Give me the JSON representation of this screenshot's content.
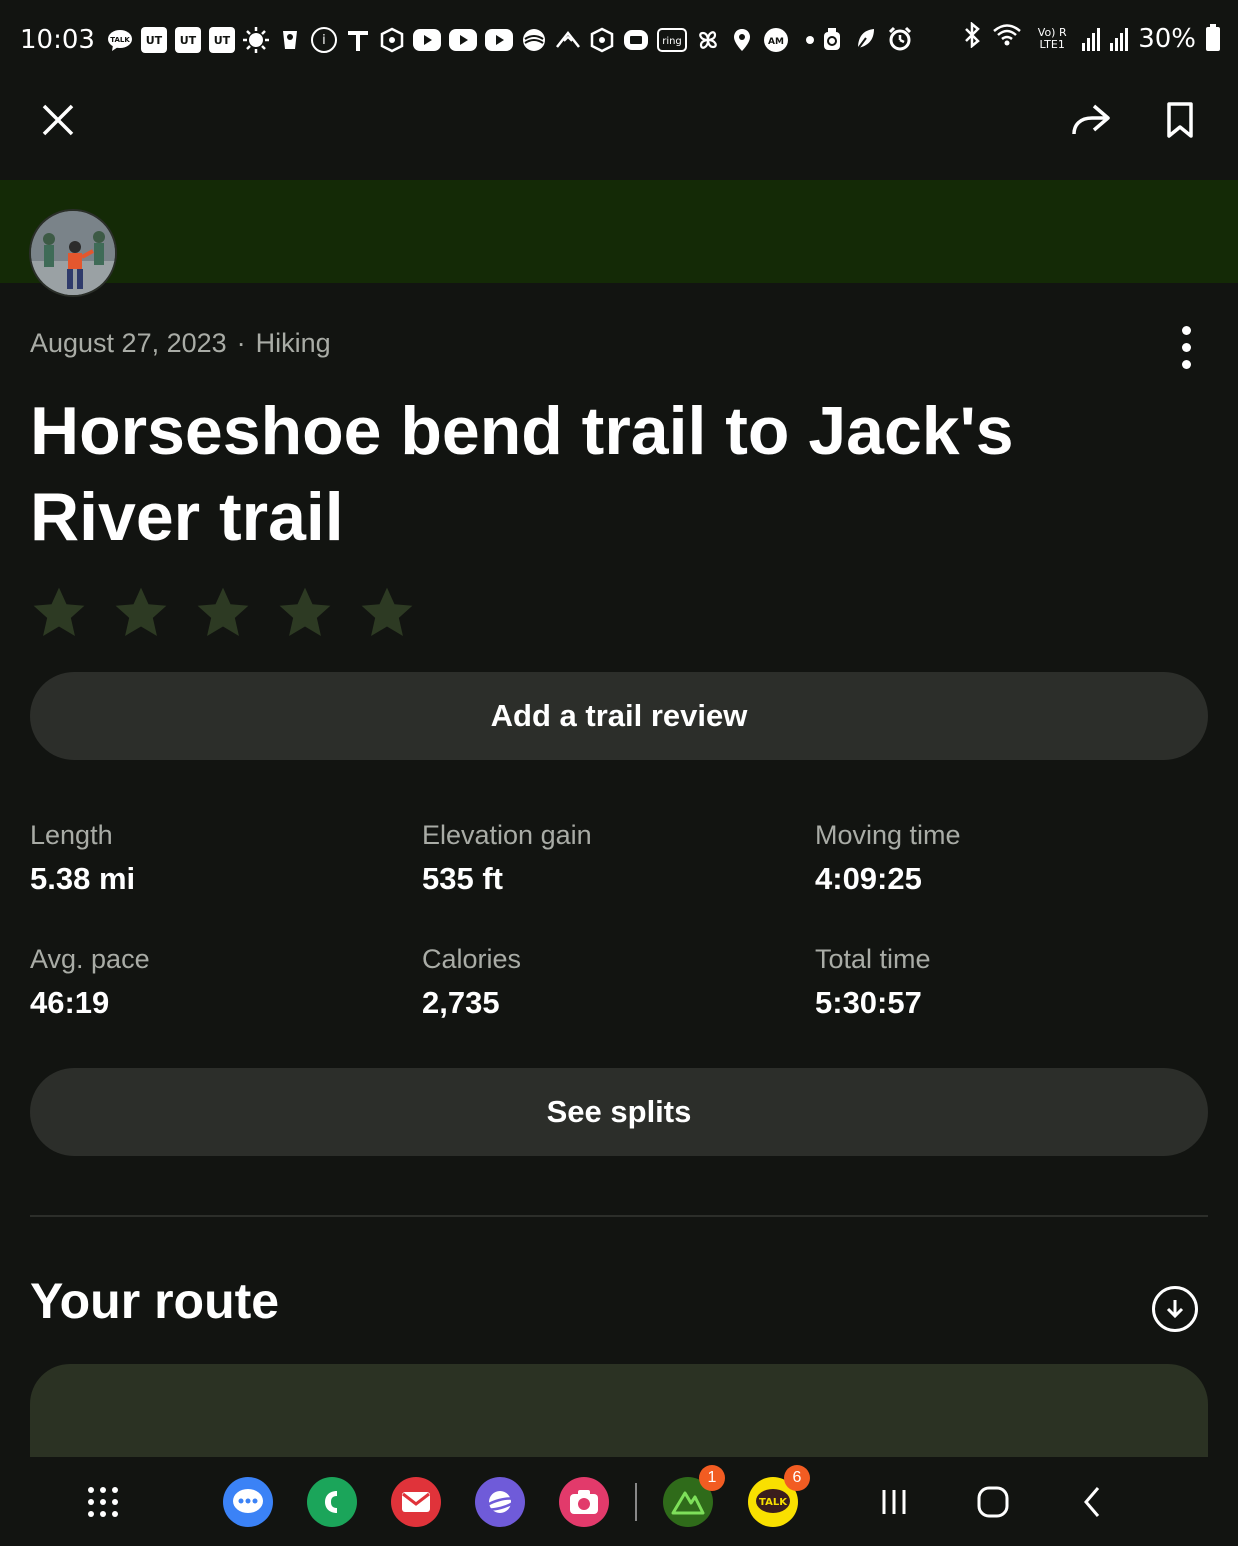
{
  "status_bar": {
    "time": "10:03",
    "battery": "30%",
    "notification_icons": [
      "talk-icon",
      "ut-icon",
      "ut-icon",
      "ut-icon",
      "sun-icon",
      "cup-icon",
      "info-icon",
      "t-icon",
      "hexagon-icon",
      "youtube-icon",
      "youtube-icon",
      "youtube-icon",
      "swirl-icon",
      "mountain-icon",
      "hexagon-icon",
      "card-icon",
      "ring-icon",
      "fan-icon",
      "location-icon",
      "am-icon"
    ],
    "box_labels": [
      "UT",
      "UT",
      "UT"
    ],
    "ring_label": "ring",
    "talk_label": "TALK",
    "net_label": "Vo) R LTE1"
  },
  "top_bar": {
    "close_icon": "close-icon",
    "share_icon": "share-icon",
    "bookmark_icon": "bookmark-icon"
  },
  "activity": {
    "date": "August 27, 2023",
    "separator": "·",
    "type": "Hiking",
    "title": "Horseshoe bend trail to Jack's River trail",
    "rating_stars": 5,
    "rating_filled": 0,
    "star_color": "#2d3a23",
    "banner_color": "#142a06"
  },
  "buttons": {
    "review": "Add a trail review",
    "splits": "See splits"
  },
  "stats": [
    {
      "label": "Length",
      "value": "5.38 mi"
    },
    {
      "label": "Elevation gain",
      "value": "535 ft"
    },
    {
      "label": "Moving time",
      "value": "4:09:25"
    },
    {
      "label": "Avg. pace",
      "value": "46:19"
    },
    {
      "label": "Calories",
      "value": "2,735"
    },
    {
      "label": "Total time",
      "value": "5:30:57"
    }
  ],
  "route": {
    "heading": "Your route",
    "download_icon": "download-icon"
  },
  "nav_bar": {
    "apps": [
      {
        "name": "apps-grid-icon"
      },
      {
        "name": "messages-icon",
        "color": "#3b82f6"
      },
      {
        "name": "phone-icon",
        "color": "#1ba55a"
      },
      {
        "name": "mail-icon",
        "color": "#e0333a"
      },
      {
        "name": "internet-icon",
        "color": "#6f5bd9"
      },
      {
        "name": "camera-icon",
        "color": "#e23a6b"
      },
      {
        "name": "alltrails-icon",
        "color": "#2f6b1a",
        "badge": "1"
      },
      {
        "name": "kakaotalk-icon",
        "color": "#f9e000",
        "badge": "6"
      }
    ],
    "kakaotalk_label": "TALK",
    "system": [
      "recents-icon",
      "home-icon",
      "back-icon"
    ]
  }
}
